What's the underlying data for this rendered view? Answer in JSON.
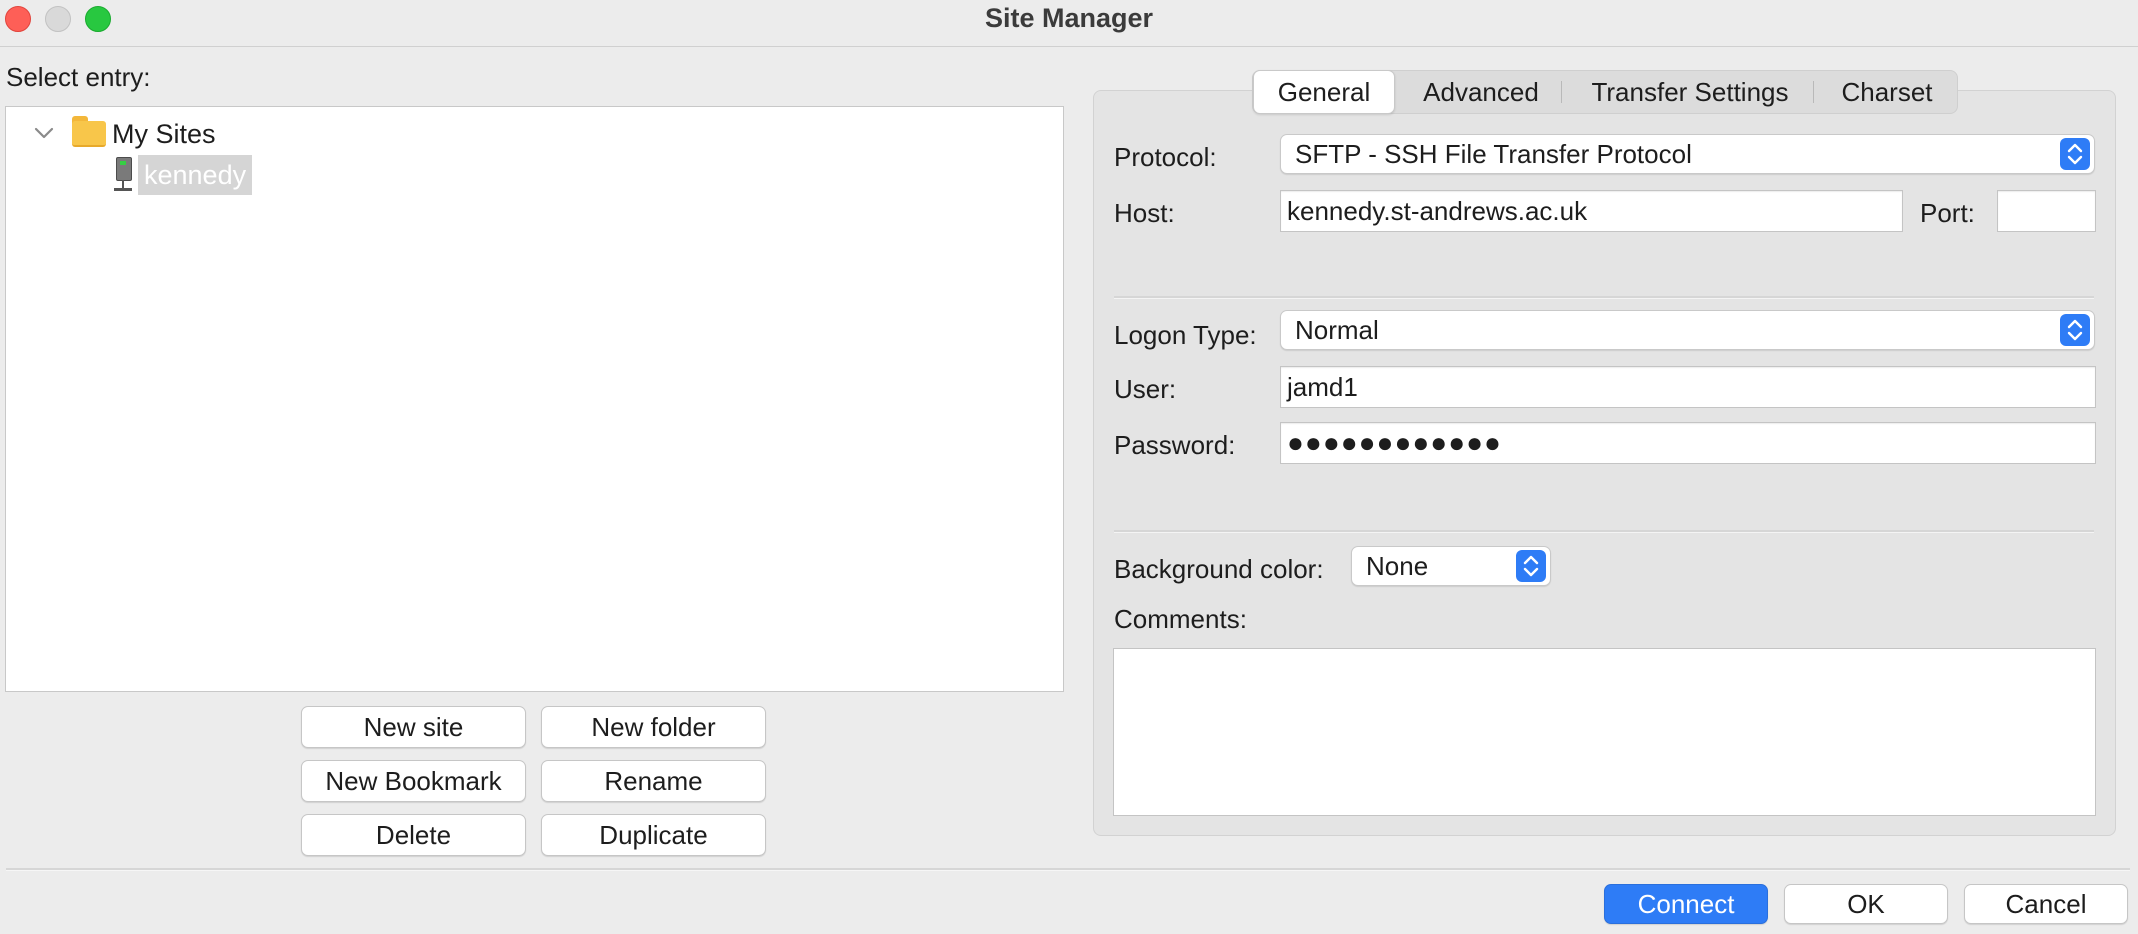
{
  "window": {
    "title": "Site Manager"
  },
  "tree": {
    "select_label": "Select entry:",
    "root_label": "My Sites",
    "site_label": "kennedy"
  },
  "tree_buttons": {
    "new_site": "New site",
    "new_folder": "New folder",
    "new_bookmark": "New Bookmark",
    "rename": "Rename",
    "delete": "Delete",
    "duplicate": "Duplicate"
  },
  "tabs": [
    {
      "label": "General",
      "active": true
    },
    {
      "label": "Advanced",
      "active": false
    },
    {
      "label": "Transfer Settings",
      "active": false
    },
    {
      "label": "Charset",
      "active": false
    }
  ],
  "general": {
    "protocol_label": "Protocol:",
    "protocol_value": "SFTP - SSH File Transfer Protocol",
    "host_label": "Host:",
    "host_value": "kennedy.st-andrews.ac.uk",
    "port_label": "Port:",
    "port_value": "",
    "logon_type_label": "Logon Type:",
    "logon_type_value": "Normal",
    "user_label": "User:",
    "user_value": "jamd1",
    "password_label": "Password:",
    "password_value": "●●●●●●●●●●●●",
    "bg_color_label": "Background color:",
    "bg_color_value": "None",
    "comments_label": "Comments:",
    "comments_value": ""
  },
  "dialog_buttons": {
    "connect": "Connect",
    "ok": "OK",
    "cancel": "Cancel"
  },
  "colors": {
    "accent": "#2e7cf6",
    "close": "#fe5f57",
    "minimize": "#d9d9d9",
    "maximize": "#28c840",
    "folder": "#f8c64a"
  },
  "icons": {
    "tree_toggle": "chevron-down-icon",
    "root": "folder-icon",
    "site": "server-icon",
    "select_arrows": "up-down-chevron-icon"
  }
}
